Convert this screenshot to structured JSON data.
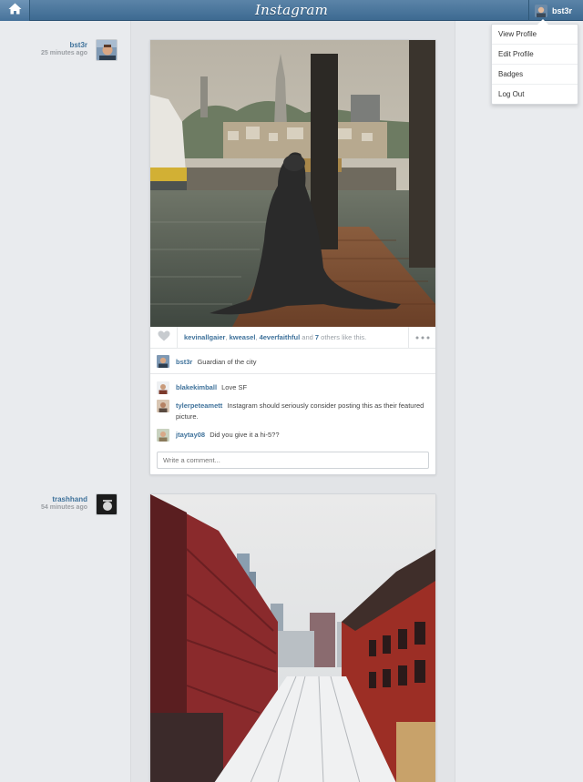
{
  "header": {
    "logo": "Instagram",
    "username": "bst3r"
  },
  "menu": {
    "items": [
      "View Profile",
      "Edit Profile",
      "Badges",
      "Log Out"
    ]
  },
  "posts": [
    {
      "user": "bst3r",
      "time": "25 minutes ago",
      "likers": [
        "kevinallgaier",
        "kweasel",
        "4everfaithful"
      ],
      "likes_and": "and",
      "likes_others": "7",
      "likes_suffix": "others like this.",
      "caption_user": "bst3r",
      "caption": "Guardian of the city",
      "comments": [
        {
          "user": "blakekimball",
          "text": "Love SF"
        },
        {
          "user": "tylerpeteamett",
          "text": "Instagram should seriously consider posting this as their featured picture."
        },
        {
          "user": "jtaytay08",
          "text": "Did you give it a hi-5??"
        }
      ],
      "comment_placeholder": "Write a comment..."
    },
    {
      "user": "trashhand",
      "time": "54 minutes ago"
    }
  ],
  "colors": {
    "accent": "#3f729b",
    "header": "#4a769c",
    "background": "#e9ebee"
  },
  "icons": {
    "home": "home-icon",
    "like": "heart-icon",
    "more": "more-icon"
  }
}
